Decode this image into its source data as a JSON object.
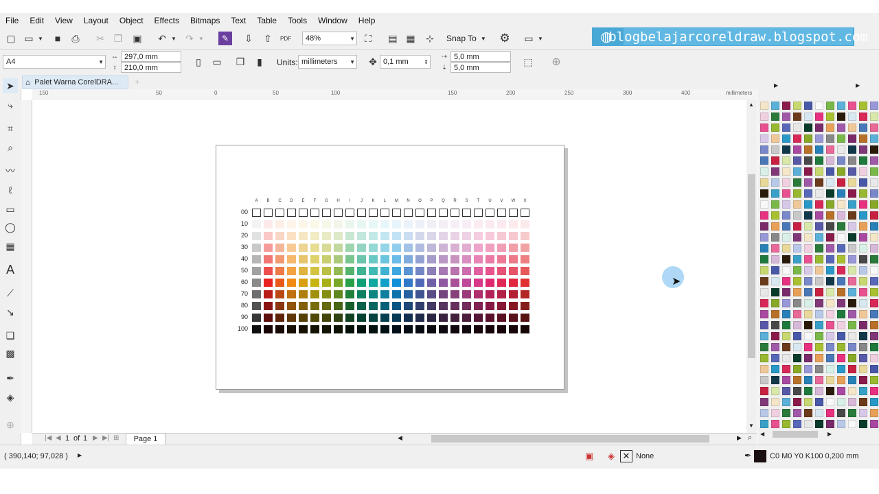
{
  "menu": [
    "File",
    "Edit",
    "View",
    "Layout",
    "Object",
    "Effects",
    "Bitmaps",
    "Text",
    "Table",
    "Tools",
    "Window",
    "Help"
  ],
  "toolbar1": {
    "zoom": "48%",
    "snap_label": "Snap To"
  },
  "banner": {
    "text": "blogbelajarcoreldraw.blogspot.com"
  },
  "toolbar2": {
    "page_size": "A4",
    "width": "297,0 mm",
    "height": "210,0 mm",
    "units_label": "Units:",
    "units_value": "millimeters",
    "nudge": "0,1 mm",
    "dup_x": "5,0 mm",
    "dup_y": "5,0 mm"
  },
  "document_tab": "Palet Warna CorelDRA...",
  "ruler": {
    "h_ticks": [
      "150",
      "50",
      "0",
      "50",
      "100",
      "150",
      "200",
      "250",
      "300",
      "400"
    ],
    "units": "millimeters"
  },
  "page_nav": {
    "current": "1",
    "of_label": "of",
    "total": "1",
    "page_tab": "Page 1"
  },
  "status": {
    "coordinates": "( 390,140; 97,028 )",
    "fill_label": "None",
    "outline_label": "C0 M0 Y0 K100  0,200 mm"
  },
  "chart_data": {
    "type": "heatmap",
    "columns": [
      "A",
      "B",
      "C",
      "D",
      "E",
      "F",
      "G",
      "H",
      "I",
      "J",
      "K",
      "L",
      "M",
      "N",
      "O",
      "P",
      "Q",
      "R",
      "S",
      "T",
      "U",
      "V",
      "W",
      "X"
    ],
    "rows": [
      "00",
      "10",
      "20",
      "30",
      "40",
      "50",
      "60",
      "70",
      "80",
      "90",
      "100"
    ],
    "hues": [
      "#8a8a8a",
      "#e8231f",
      "#e85a1a",
      "#f08c14",
      "#d8a010",
      "#c8b410",
      "#a8b018",
      "#78a828",
      "#28a048",
      "#10a078",
      "#10a8a0",
      "#10a0c8",
      "#1090d8",
      "#3078c8",
      "#5068b8",
      "#7060a8",
      "#9058a0",
      "#a85098",
      "#c04898",
      "#d83888",
      "#e02870",
      "#e02858",
      "#e02840",
      "#e03030"
    ],
    "tint_levels": [
      0.0,
      0.1,
      0.25,
      0.45,
      0.62,
      0.8,
      1.0,
      0.8,
      0.6,
      0.4,
      0.1
    ]
  }
}
